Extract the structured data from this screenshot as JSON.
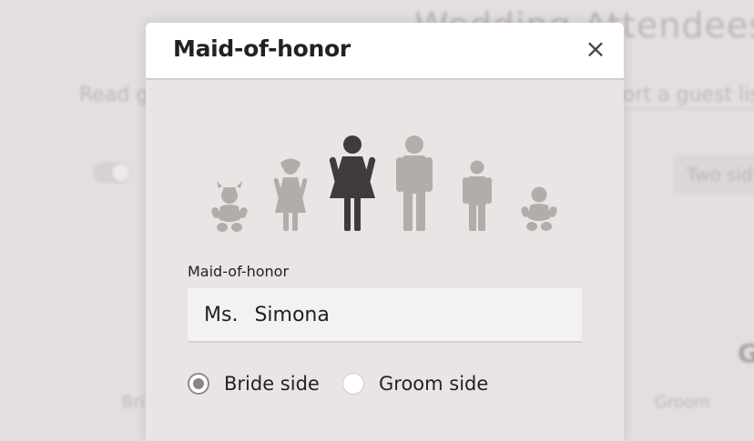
{
  "background": {
    "title": "Wedding Attendees",
    "read_text": "Read g",
    "import_link": "ort a guest lis",
    "two_sides_label": "Two sid",
    "bride_col": "Bri",
    "groom_col": "Groom",
    "g_letter": "G"
  },
  "modal": {
    "title": "Maid-of-honor",
    "close_icon": "×",
    "role_icons": [
      "baby-girl-icon",
      "girl-icon",
      "woman-icon",
      "man-icon",
      "boy-icon",
      "baby-boy-icon"
    ],
    "selected_role": "woman-icon",
    "field_label": "Maid-of-honor",
    "salutation": "Ms.",
    "name": "Simona",
    "side_options": [
      {
        "label": "Bride side",
        "checked": true
      },
      {
        "label": "Groom side",
        "checked": false
      }
    ]
  },
  "colors": {
    "icon_selected": "#3f3b3b",
    "icon_unselected": "#b2acab",
    "modal_bg": "#e9e5e5",
    "header_bg": "#ffffff"
  }
}
